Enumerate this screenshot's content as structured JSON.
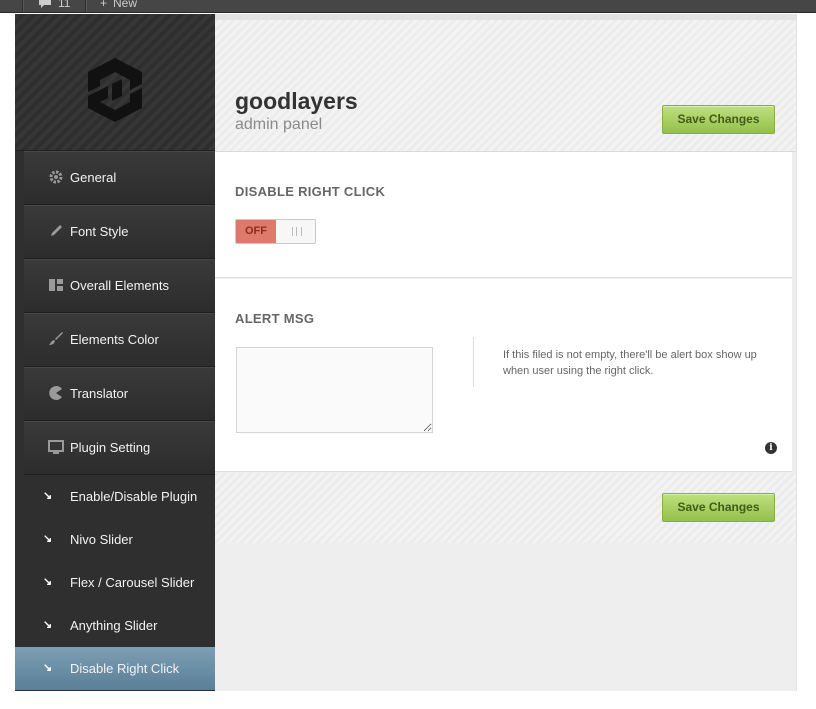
{
  "admin_bar": {
    "comments_count": "11",
    "new_label": "New"
  },
  "brand": {
    "title": "goodlayers",
    "subtitle": "admin panel"
  },
  "buttons": {
    "save_top": "Save Changes",
    "save_bottom": "Save Changes"
  },
  "sidebar": {
    "items": [
      {
        "label": "General",
        "icon": "gear-icon"
      },
      {
        "label": "Font Style",
        "icon": "pencil-icon"
      },
      {
        "label": "Overall Elements",
        "icon": "layout-icon"
      },
      {
        "label": "Elements Color",
        "icon": "brush-icon"
      },
      {
        "label": "Translator",
        "icon": "pacman-icon"
      },
      {
        "label": "Plugin Setting",
        "icon": "monitor-icon"
      }
    ],
    "subitems": [
      {
        "label": "Enable/Disable Plugin",
        "active": false
      },
      {
        "label": "Nivo Slider",
        "active": false
      },
      {
        "label": "Flex / Carousel Slider",
        "active": false
      },
      {
        "label": "Anything Slider",
        "active": false
      },
      {
        "label": "Disable Right Click",
        "active": true
      }
    ]
  },
  "sections": {
    "disable_right_click": {
      "title": "DISABLE RIGHT CLICK",
      "toggle_state": "OFF"
    },
    "alert_msg": {
      "title": "ALERT MSG",
      "value": "",
      "description": "If this filed is not empty, there'll be alert box show up when user using the right click.",
      "info_icon": "i"
    }
  },
  "colors": {
    "save_button": "#93c04b",
    "toggle_off": "#de7a6a",
    "active_nav": "#6a8fa5",
    "sidebar_bg": "#2f2f2f"
  }
}
